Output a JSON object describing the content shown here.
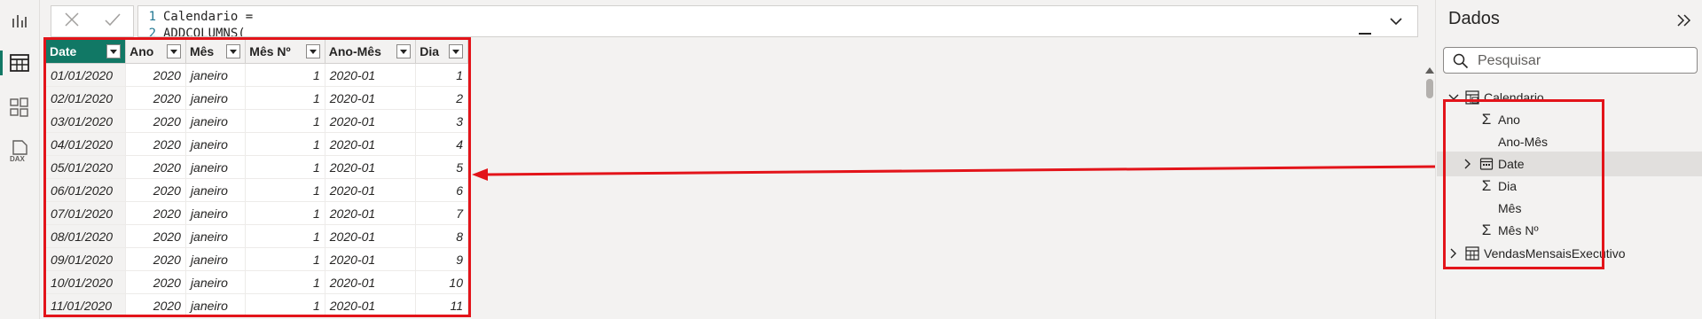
{
  "rail": {
    "items": [
      {
        "name": "report-view-icon"
      },
      {
        "name": "table-view-icon",
        "active": true
      },
      {
        "name": "model-view-icon"
      },
      {
        "name": "dax-query-view-icon",
        "label": "DAX"
      }
    ]
  },
  "formula_bar": {
    "line1_number": "1",
    "line1_text": "Calendario =",
    "line2_number": "2",
    "line2_text": "ADDCOLUMNS("
  },
  "table": {
    "columns": [
      "Date",
      "Ano",
      "Mês",
      "Mês Nº",
      "Ano-Mês",
      "Dia"
    ],
    "active_column": "Date",
    "rows": [
      [
        "01/01/2020",
        "2020",
        "janeiro",
        "1",
        "2020-01",
        "1"
      ],
      [
        "02/01/2020",
        "2020",
        "janeiro",
        "1",
        "2020-01",
        "2"
      ],
      [
        "03/01/2020",
        "2020",
        "janeiro",
        "1",
        "2020-01",
        "3"
      ],
      [
        "04/01/2020",
        "2020",
        "janeiro",
        "1",
        "2020-01",
        "4"
      ],
      [
        "05/01/2020",
        "2020",
        "janeiro",
        "1",
        "2020-01",
        "5"
      ],
      [
        "06/01/2020",
        "2020",
        "janeiro",
        "1",
        "2020-01",
        "6"
      ],
      [
        "07/01/2020",
        "2020",
        "janeiro",
        "1",
        "2020-01",
        "7"
      ],
      [
        "08/01/2020",
        "2020",
        "janeiro",
        "1",
        "2020-01",
        "8"
      ],
      [
        "09/01/2020",
        "2020",
        "janeiro",
        "1",
        "2020-01",
        "9"
      ],
      [
        "10/01/2020",
        "2020",
        "janeiro",
        "1",
        "2020-01",
        "10"
      ],
      [
        "11/01/2020",
        "2020",
        "janeiro",
        "1",
        "2020-01",
        "11"
      ]
    ]
  },
  "panel": {
    "title": "Dados",
    "search_placeholder": "Pesquisar",
    "tree": [
      {
        "label": "Calendario",
        "icon": "calendar-table-icon",
        "expanded": true,
        "level": 0
      },
      {
        "label": "Ano",
        "icon": "sigma-icon",
        "level": 1
      },
      {
        "label": "Ano-Mês",
        "icon": "",
        "level": 1
      },
      {
        "label": "Date",
        "icon": "date-hierarchy-icon",
        "expandable": true,
        "level": 1,
        "selected": true
      },
      {
        "label": "Dia",
        "icon": "sigma-icon",
        "level": 1
      },
      {
        "label": "Mês",
        "icon": "",
        "level": 1
      },
      {
        "label": "Mês Nº",
        "icon": "sigma-icon",
        "level": 1
      },
      {
        "label": "VendasMensaisExecutivo",
        "icon": "table-icon",
        "expanded": false,
        "level": 0
      }
    ]
  },
  "colors": {
    "accent": "#117865",
    "highlight_red": "#e3141a",
    "panel_bg": "#f3f2f1"
  }
}
